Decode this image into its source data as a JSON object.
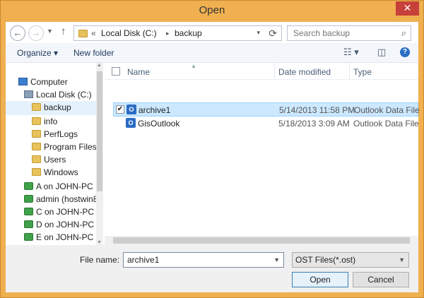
{
  "window": {
    "title": "Open"
  },
  "nav": {
    "back": "←",
    "forward": "→",
    "up": "↑"
  },
  "address": {
    "prefix": "«",
    "segment1": "Local Disk (C:)",
    "separator": "▸",
    "segment2": "backup"
  },
  "search": {
    "placeholder": "Search backup"
  },
  "toolbar": {
    "organize_label": "Organize ▾",
    "new_folder_label": "New folder",
    "help_label": "?"
  },
  "sidebar": {
    "items": [
      {
        "label": "Computer",
        "icon": "computer-icon"
      },
      {
        "label": "Local Disk (C:)",
        "icon": "disk-icon"
      },
      {
        "label": "backup",
        "icon": "folder-icon",
        "selected": true
      },
      {
        "label": "info",
        "icon": "folder-icon"
      },
      {
        "label": "PerfLogs",
        "icon": "folder-icon"
      },
      {
        "label": "Program Files",
        "icon": "folder-icon"
      },
      {
        "label": "Users",
        "icon": "folder-icon"
      },
      {
        "label": "Windows",
        "icon": "folder-icon"
      },
      {
        "label": "A on JOHN-PC",
        "icon": "network-drive-icon"
      },
      {
        "label": "admin (hostwin8",
        "icon": "network-drive-icon"
      },
      {
        "label": "C on JOHN-PC",
        "icon": "network-drive-icon"
      },
      {
        "label": "D on JOHN-PC",
        "icon": "network-drive-icon"
      },
      {
        "label": "E on JOHN-PC",
        "icon": "network-drive-icon"
      }
    ]
  },
  "filelist": {
    "columns": {
      "name": "Name",
      "date": "Date modified",
      "type": "Type"
    },
    "rows": [
      {
        "name": "archive1",
        "date": "5/14/2013 11:58 PM",
        "type": "Outlook Data File",
        "selected": true,
        "checked": "✔"
      },
      {
        "name": "GisOutlook",
        "date": "5/18/2013 3:09 AM",
        "type": "Outlook Data File"
      }
    ]
  },
  "bottom": {
    "file_name_label": "File name:",
    "file_name_value": "archive1",
    "file_type": "OST Files(*.ost)",
    "open_label": "Open",
    "cancel_label": "Cancel"
  },
  "colors": {
    "accent": "#f0b050",
    "selection": "#cce8ff",
    "close": "#c7403a"
  }
}
